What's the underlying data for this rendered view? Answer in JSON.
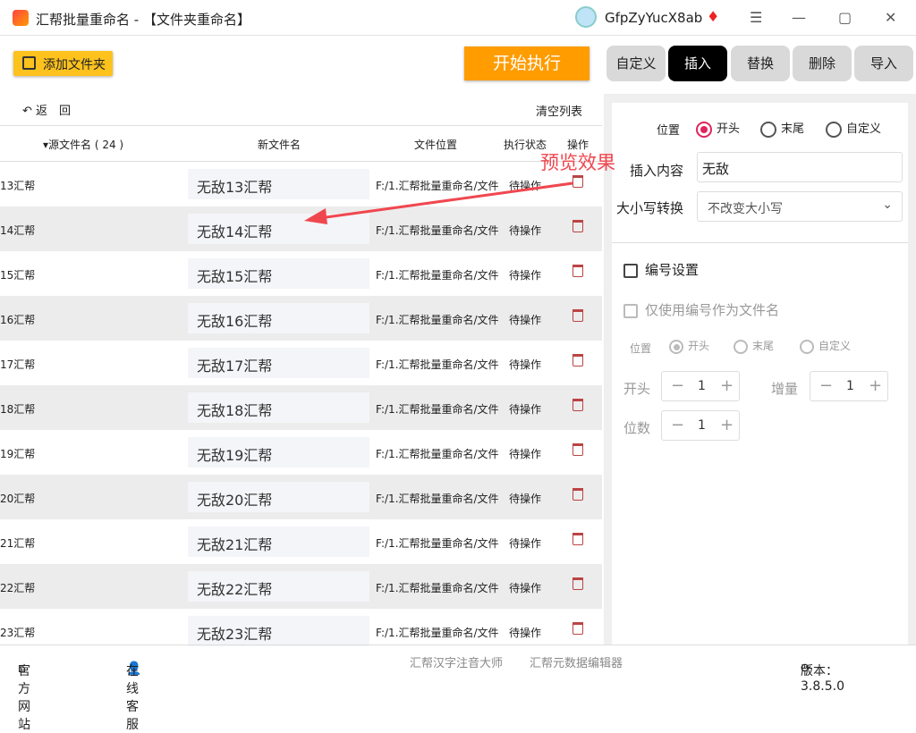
{
  "app": {
    "title": "汇帮批量重命名 - 【文件夹重命名】",
    "user": "GfpZyYucX8ab",
    "vip_icon": "vip-diamond-icon"
  },
  "window": {
    "menu": "☰",
    "minimize": "—",
    "maximize": "▢",
    "close": "✕"
  },
  "toolbar": {
    "add_folder": "添加文件夹",
    "start": "开始执行"
  },
  "tabs": [
    {
      "label": "自定义"
    },
    {
      "label": "插入",
      "active": true
    },
    {
      "label": "替换"
    },
    {
      "label": "删除"
    },
    {
      "label": "导入"
    }
  ],
  "list": {
    "back": "返　回",
    "clear": "清空列表",
    "headers": {
      "source": "▾源文件名 ( 24 )",
      "new": "新文件名",
      "location": "文件位置",
      "status": "执行状态",
      "action": "操作"
    },
    "rows": [
      {
        "source": "13汇帮",
        "new": "无敌13汇帮",
        "location": "F:/1.汇帮批量重命名/文件",
        "status": "待操作"
      },
      {
        "source": "14汇帮",
        "new": "无敌14汇帮",
        "location": "F:/1.汇帮批量重命名/文件",
        "status": "待操作"
      },
      {
        "source": "15汇帮",
        "new": "无敌15汇帮",
        "location": "F:/1.汇帮批量重命名/文件",
        "status": "待操作"
      },
      {
        "source": "16汇帮",
        "new": "无敌16汇帮",
        "location": "F:/1.汇帮批量重命名/文件",
        "status": "待操作"
      },
      {
        "source": "17汇帮",
        "new": "无敌17汇帮",
        "location": "F:/1.汇帮批量重命名/文件",
        "status": "待操作"
      },
      {
        "source": "18汇帮",
        "new": "无敌18汇帮",
        "location": "F:/1.汇帮批量重命名/文件",
        "status": "待操作"
      },
      {
        "source": "19汇帮",
        "new": "无敌19汇帮",
        "location": "F:/1.汇帮批量重命名/文件",
        "status": "待操作"
      },
      {
        "source": "20汇帮",
        "new": "无敌20汇帮",
        "location": "F:/1.汇帮批量重命名/文件",
        "status": "待操作"
      },
      {
        "source": "21汇帮",
        "new": "无敌21汇帮",
        "location": "F:/1.汇帮批量重命名/文件",
        "status": "待操作"
      },
      {
        "source": "22汇帮",
        "new": "无敌22汇帮",
        "location": "F:/1.汇帮批量重命名/文件",
        "status": "待操作"
      },
      {
        "source": "23汇帮",
        "new": "无敌23汇帮",
        "location": "F:/1.汇帮批量重命名/文件",
        "status": "待操作"
      }
    ]
  },
  "annotation": {
    "text": "预览效果",
    "color": "#f0474f"
  },
  "insert": {
    "position_label": "位置",
    "positions": [
      "开头",
      "末尾",
      "自定义"
    ],
    "selected": "开头",
    "content_label": "插入内容",
    "content_value": "无敌",
    "case_label": "大小写转换",
    "case_value": "不改变大小写"
  },
  "numbering": {
    "label": "编号设置",
    "checked": false,
    "only_number_label": "仅使用编号作为文件名",
    "position_label": "位置",
    "positions": [
      "开头",
      "末尾",
      "自定义"
    ],
    "start_label": "开头",
    "start_value": "1",
    "step_label": "增量",
    "step_value": "1",
    "digits_label": "位数",
    "digits_value": "1"
  },
  "footer": {
    "website": "官方网站",
    "support": "在线客服",
    "link1": "汇帮汉字注音大师",
    "link2": "汇帮元数据编辑器",
    "version": "版本：3.8.5.0"
  },
  "colors": {
    "accent": "#e0245e",
    "start": "#ff9c00",
    "add": "#fdc21d"
  }
}
